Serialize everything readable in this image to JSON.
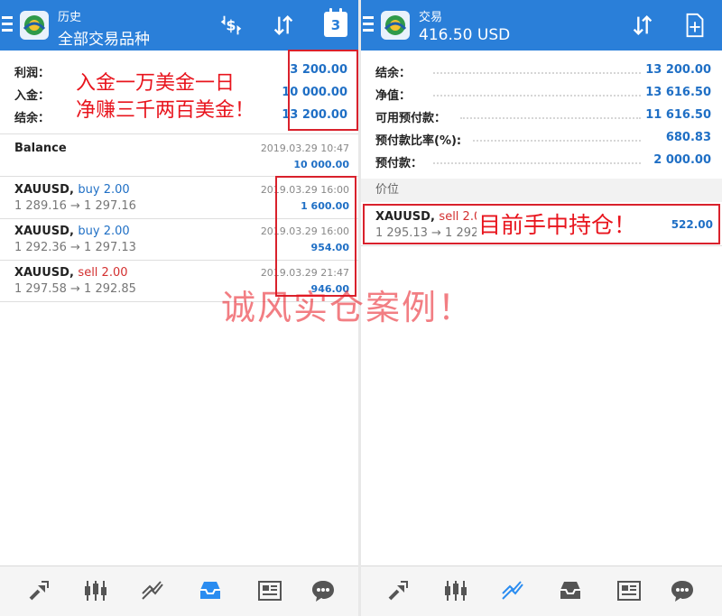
{
  "left": {
    "header": {
      "title": "历史",
      "subtitle": "全部交易品种",
      "calendar_day": "3"
    },
    "summary": [
      {
        "label": "利润：",
        "value": "3 200.00"
      },
      {
        "label": "入金：",
        "value": "10 000.00"
      },
      {
        "label": "结余：",
        "value": "13 200.00"
      }
    ],
    "balance": {
      "label": "Balance",
      "time": "2019.03.29 10:47",
      "amount": "10 000.00"
    },
    "deals": [
      {
        "symbol": "XAUUSD,",
        "side": "buy 2.00",
        "side_type": "buy",
        "prices": "1 289.16 → 1 297.16",
        "time": "2019.03.29 16:00",
        "profit": "1 600.00"
      },
      {
        "symbol": "XAUUSD,",
        "side": "buy 2.00",
        "side_type": "buy",
        "prices": "1 292.36 → 1 297.13",
        "time": "2019.03.29 16:00",
        "profit": "954.00"
      },
      {
        "symbol": "XAUUSD,",
        "side": "sell 2.00",
        "side_type": "sell",
        "prices": "1 297.58 → 1 292.85",
        "time": "2019.03.29 21:47",
        "profit": "946.00"
      }
    ],
    "annotation_line1": "入金一万美金一日",
    "annotation_line2": "净赚三千两百美金！"
  },
  "right": {
    "header": {
      "title": "交易",
      "subtitle": "416.50 USD"
    },
    "account": [
      {
        "label": "结余：",
        "value": "13 200.00"
      },
      {
        "label": "净值：",
        "value": "13 616.50"
      },
      {
        "label": "可用预付款：",
        "value": "11 616.50"
      },
      {
        "label": "预付款比率(%):",
        "value": "680.83"
      },
      {
        "label": "预付款：",
        "value": "2 000.00"
      }
    ],
    "section_label": "价位",
    "position": {
      "symbol": "XAUUSD,",
      "side": "sell 2.00",
      "prices": "1 295.13 → 1 292.52",
      "profit": "522.00"
    },
    "annotation": "目前手中持仓！"
  },
  "watermark": "诚风实仓案例！",
  "icons": {
    "header": [
      "menu-icon",
      "app-logo-icon",
      "currency-exchange-icon",
      "sort-icon",
      "calendar-icon",
      "new-order-icon"
    ],
    "nav": [
      "quotes-icon",
      "chart-icon",
      "trade-icon",
      "history-icon",
      "news-icon",
      "chat-icon"
    ]
  },
  "colors": {
    "header_bg": "#2a7fd9",
    "value_blue": "#1f6fc5",
    "sell_red": "#d32f2f",
    "annotation_red": "#e8141d",
    "nav_active": "#2a8cf0"
  }
}
